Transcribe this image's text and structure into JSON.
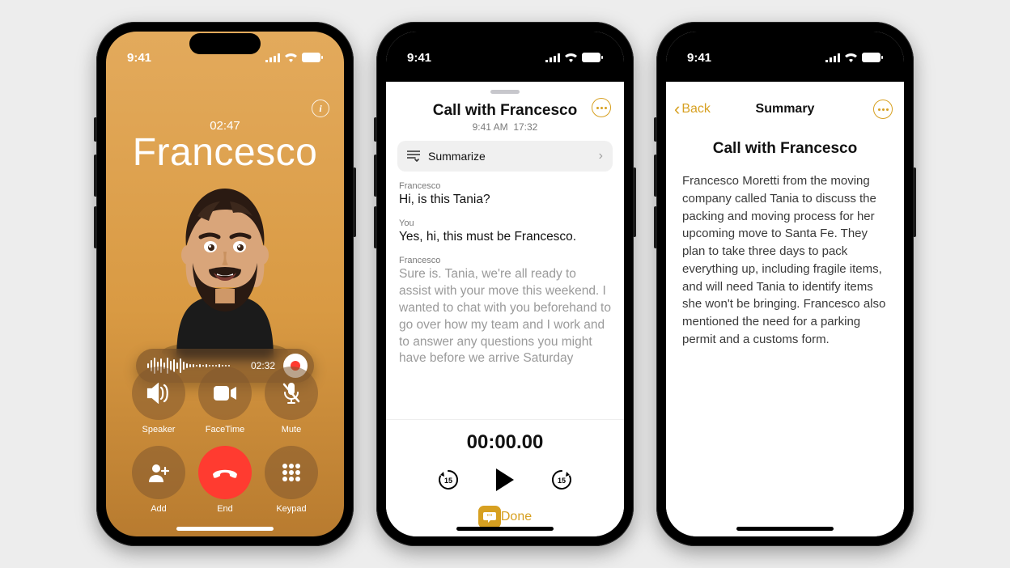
{
  "status": {
    "time": "9:41"
  },
  "call": {
    "duration": "02:47",
    "contact_name": "Francesco",
    "recording_time": "02:32",
    "buttons": {
      "speaker": "Speaker",
      "facetime": "FaceTime",
      "mute": "Mute",
      "add": "Add",
      "end": "End",
      "keypad": "Keypad"
    }
  },
  "transcript": {
    "title": "Call with Francesco",
    "meta_time": "9:41 AM",
    "meta_duration": "17:32",
    "summarize_label": "Summarize",
    "messages": [
      {
        "who": "Francesco",
        "text": "Hi, is this Tania?"
      },
      {
        "who": "You",
        "text": "Yes, hi, this must be Francesco."
      },
      {
        "who": "Francesco",
        "text": "Sure is. Tania, we're all ready to assist with your move this weekend. I wanted to chat with you beforehand to go over how my team and I work and to answer any questions you might have before we arrive Saturday"
      }
    ],
    "player_time": "00:00.00",
    "done_label": "Done"
  },
  "summary": {
    "back_label": "Back",
    "nav_title": "Summary",
    "title": "Call with Francesco",
    "body": "Francesco Moretti from the moving company called Tania to discuss the packing and moving process for her upcoming move to Santa Fe. They plan to take three days to pack everything up, including fragile items, and will need Tania to identify items she won't be bringing. Francesco also mentioned the need for a parking permit and a customs form."
  }
}
